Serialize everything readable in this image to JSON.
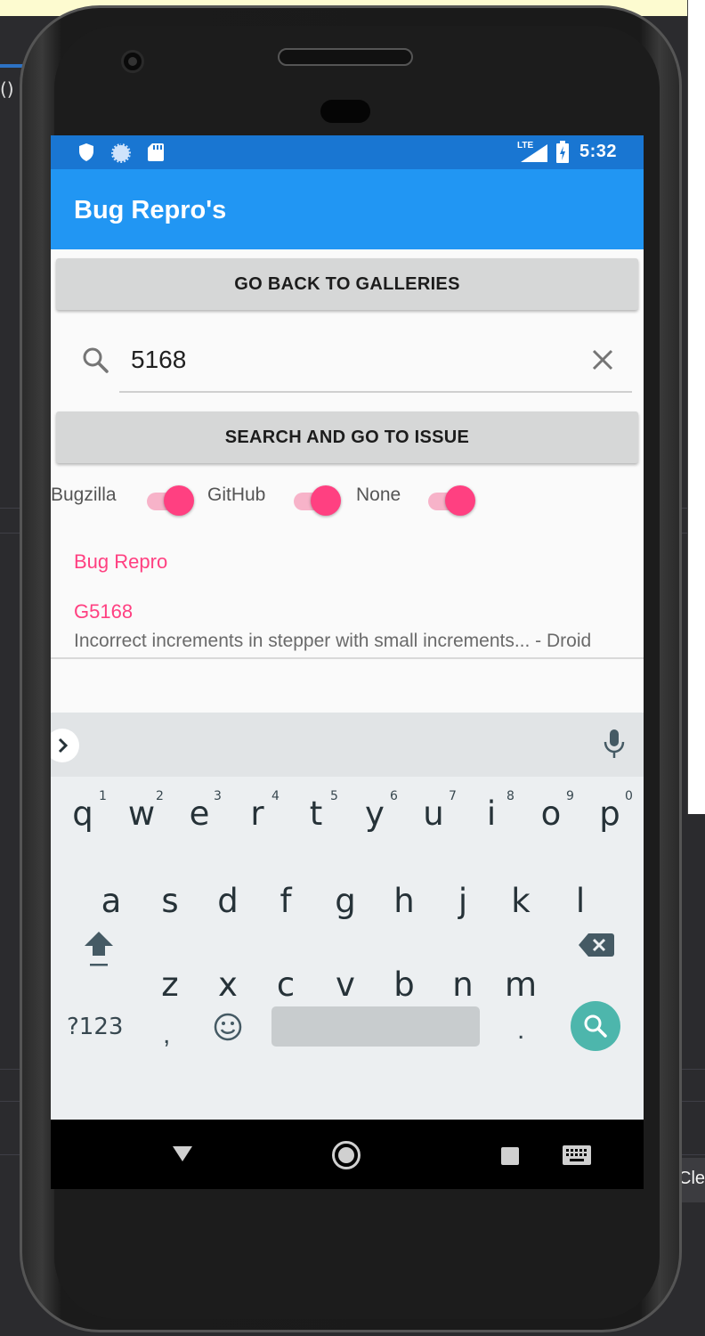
{
  "desktop": {
    "left_fragment": "()",
    "clear_button": "Cle"
  },
  "statusbar": {
    "network": "LTE",
    "time": "5:32",
    "icons": [
      "shield-icon",
      "sync-icon",
      "sd-card-icon",
      "signal-icon",
      "battery-icon"
    ]
  },
  "appbar": {
    "title": "Bug Repro's"
  },
  "buttons": {
    "galleries": "GO BACK TO GALLERIES",
    "search_issue": "SEARCH AND GO TO ISSUE"
  },
  "search": {
    "value": "5168"
  },
  "filters": [
    {
      "label": "Bugzilla",
      "on": true
    },
    {
      "label": "GitHub",
      "on": true
    },
    {
      "label": "None",
      "on": true
    }
  ],
  "list": {
    "header": "Bug Repro",
    "items": [
      {
        "title": "G5168",
        "detail": "Incorrect increments in stepper with small increments... - Droid"
      }
    ]
  },
  "keyboard": {
    "row1": [
      "q",
      "w",
      "e",
      "r",
      "t",
      "y",
      "u",
      "i",
      "o",
      "p"
    ],
    "row1_hints": [
      "1",
      "2",
      "3",
      "4",
      "5",
      "6",
      "7",
      "8",
      "9",
      "0"
    ],
    "row2": [
      "a",
      "s",
      "d",
      "f",
      "g",
      "h",
      "j",
      "k",
      "l"
    ],
    "row3": [
      "z",
      "x",
      "c",
      "v",
      "b",
      "n",
      "m"
    ],
    "symbols": "?123",
    "comma": ",",
    "period": "."
  },
  "colors": {
    "statusbar": "#1976d2",
    "appbar": "#2196f3",
    "accent": "#ff4081",
    "go_key": "#4db6ac"
  }
}
